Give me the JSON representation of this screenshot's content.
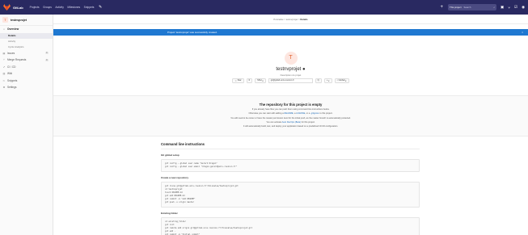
{
  "topbar": {
    "brand": "GitLab",
    "nav": [
      "Projects",
      "Groups",
      "Activity",
      "Milestones",
      "Snippets"
    ],
    "search_scope": "This project",
    "search_placeholder": "Search"
  },
  "sidebar": {
    "project_name": "testnvprojet",
    "project_initial": "T",
    "items": [
      {
        "label": "Overview",
        "icon": "home-icon"
      },
      {
        "label": "Details",
        "sub": true
      },
      {
        "label": "Activity",
        "sub": true
      },
      {
        "label": "Cycle Analytics",
        "sub": true
      },
      {
        "label": "Issues",
        "icon": "issues-icon",
        "count": "0"
      },
      {
        "label": "Merge Requests",
        "icon": "merge-icon",
        "count": "0"
      },
      {
        "label": "CI / CD",
        "icon": "rocket-icon"
      },
      {
        "label": "Wiki",
        "icon": "book-icon"
      },
      {
        "label": "Snippets",
        "icon": "scissors-icon"
      },
      {
        "label": "Settings",
        "icon": "gear-icon"
      }
    ]
  },
  "breadcrumb": {
    "part1": "Poisnalse",
    "part2": "testnvprojet",
    "current": "Details"
  },
  "flash": {
    "message": "Project 'testnvprojet' was successfully created."
  },
  "project": {
    "initial": "T",
    "title": "testnvprojet",
    "description": "Description du projet",
    "star_label": "Star",
    "star_count": "0",
    "ssh_label": "SSH",
    "clone_url": "git@gitlab.univ-reunion.fr",
    "add_label": "+",
    "global_label": "Global"
  },
  "empty": {
    "title": "The repository for this project is empty",
    "line1": "If you already have files you can push them using command line instructions below.",
    "line2_pre": "Otherwise you can start with adding a ",
    "readme": "README",
    "sep1": ", a ",
    "license": "LICENSE",
    "sep2": ", or a ",
    "gitignore": ".gitignore",
    "line2_post": " to this project.",
    "line3": "You will need to be owner or have the master permission level for the initial push, as the master branch is automatically protected.",
    "line4_pre": "You can activate ",
    "autodevops": "Auto DevOps (Beta)",
    "line4_post": " for this project.",
    "line5": "It will automatically build, test, and deploy your application based on a predefined CI/CD configuration."
  },
  "instructions": {
    "title": "Command line instructions",
    "global_title": "Git global setup",
    "global_code": "git config --global user.name \"Gerard Dragon\"\ngit config --global user.email \"dragon.gerard@univ-reunion.fr\"",
    "new_title": "Create a new repository",
    "new_code": "git clone git@gitlab.univ-reunion.fr:Poisnalse/testnvprojet.git\ncd testnvprojet\ntouch README.md\ngit add README.md\ngit commit -m \"add README\"\ngit push -u origin master",
    "existing_title": "Existing folder",
    "existing_code": "cd existing_folder\ngit init\ngit remote add origin git@gitlab.univ-reunion.fr:Poisnalse/testnvprojet.git\ngit add .\ngit commit -m \"Initial commit\""
  }
}
